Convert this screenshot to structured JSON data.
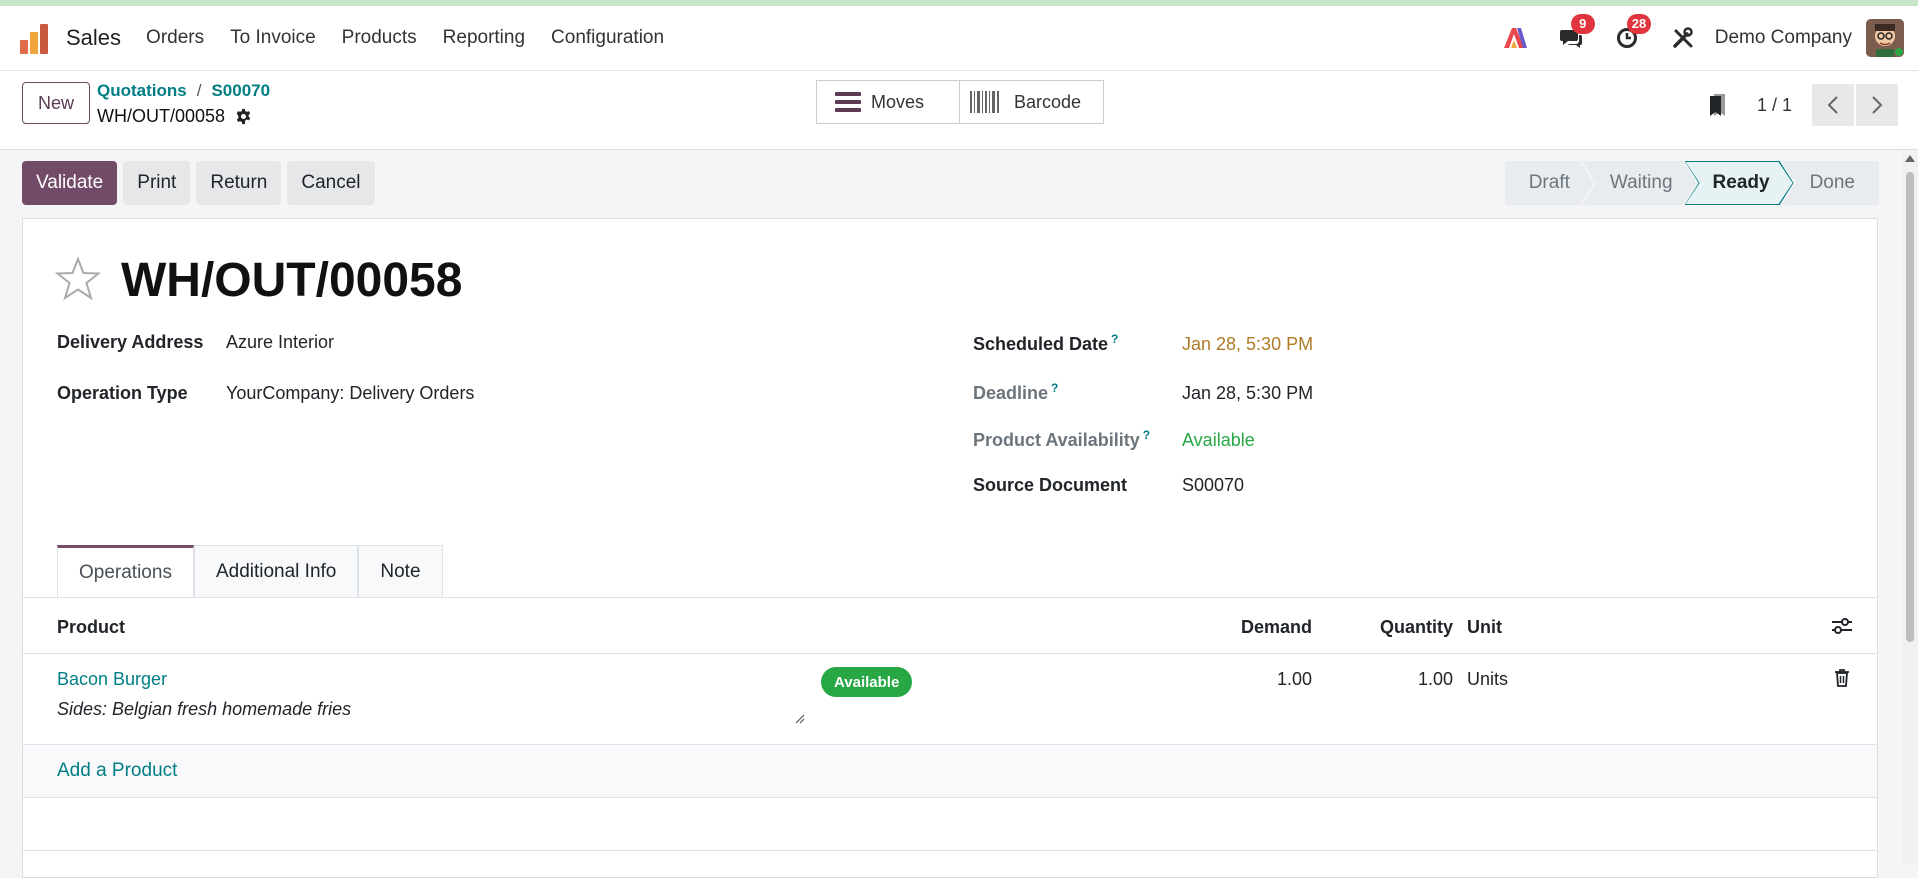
{
  "navbar": {
    "app_name": "Sales",
    "menu": [
      "Orders",
      "To Invoice",
      "Products",
      "Reporting",
      "Configuration"
    ],
    "messages_count": "9",
    "activities_count": "28",
    "company": "Demo Company"
  },
  "control": {
    "new_label": "New",
    "breadcrumb": [
      "Quotations",
      "S00070"
    ],
    "record_name": "WH/OUT/00058",
    "smart_buttons": {
      "moves": "Moves",
      "barcode": "Barcode"
    },
    "pager": "1 / 1"
  },
  "actions": [
    "Validate",
    "Print",
    "Return",
    "Cancel"
  ],
  "stages": {
    "items": [
      "Draft",
      "Waiting",
      "Ready",
      "Done"
    ],
    "active": "Ready"
  },
  "record": {
    "title": "WH/OUT/00058",
    "delivery_address_label": "Delivery Address",
    "delivery_address": "Azure Interior",
    "operation_type_label": "Operation Type",
    "operation_type": "YourCompany: Delivery Orders",
    "scheduled_date_label": "Scheduled Date",
    "scheduled_date": "Jan 28, 5:30 PM",
    "deadline_label": "Deadline",
    "deadline": "Jan 28, 5:30 PM",
    "availability_label": "Product Availability",
    "availability": "Available",
    "source_label": "Source Document",
    "source": "S00070",
    "help_mark": "?"
  },
  "tabs": [
    "Operations",
    "Additional Info",
    "Note"
  ],
  "table": {
    "headers": {
      "product": "Product",
      "demand": "Demand",
      "quantity": "Quantity",
      "unit": "Unit"
    },
    "rows": [
      {
        "product": "Bacon Burger",
        "description": "Sides: Belgian fresh homemade fries",
        "status": "Available",
        "demand": "1.00",
        "quantity": "1.00",
        "unit": "Units"
      }
    ],
    "add_label": "Add a Product"
  },
  "colors": {
    "primary": "#714b67",
    "link": "#017e84",
    "success": "#28a745",
    "warning_date": "#b07b26"
  }
}
